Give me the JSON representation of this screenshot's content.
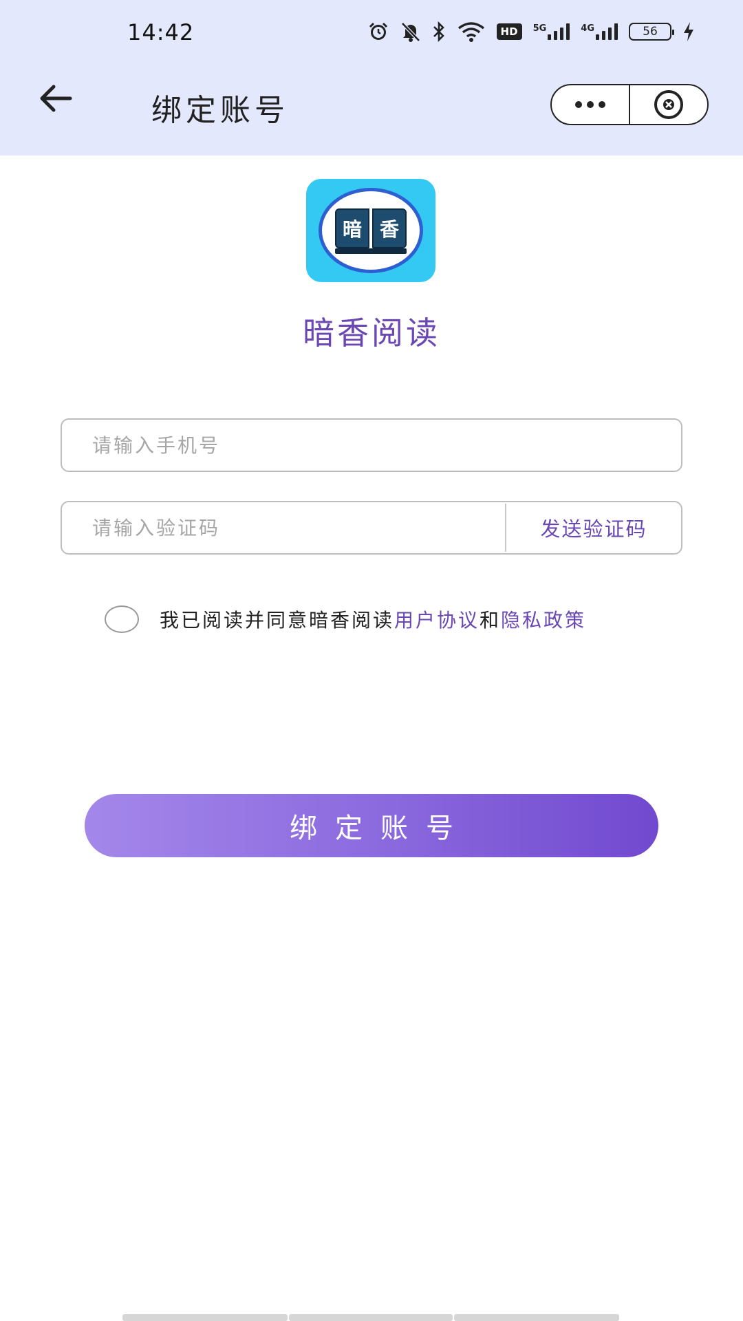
{
  "status_bar": {
    "time": "14:42",
    "network_badge": "HD",
    "signal_1_label": "5G",
    "signal_2_label": "4G",
    "battery": "56"
  },
  "header": {
    "title": "绑定账号",
    "background": "#e3e8fc"
  },
  "app": {
    "logo_text_left": "暗",
    "logo_text_right": "香",
    "name": "暗香阅读"
  },
  "form": {
    "phone_placeholder": "请输入手机号",
    "code_placeholder": "请输入验证码",
    "send_code_label": "发送验证码",
    "agreement_prefix": "我已阅读并同意暗香阅读",
    "user_agreement_link": "用户协议",
    "agreement_and": "和",
    "privacy_policy_link": "隐私政策",
    "submit_label": "绑定账号"
  },
  "colors": {
    "accent": "#6a47b3",
    "button_gradient_start": "#a487ea",
    "button_gradient_end": "#7149cf",
    "logo_background": "#33c9f3"
  }
}
